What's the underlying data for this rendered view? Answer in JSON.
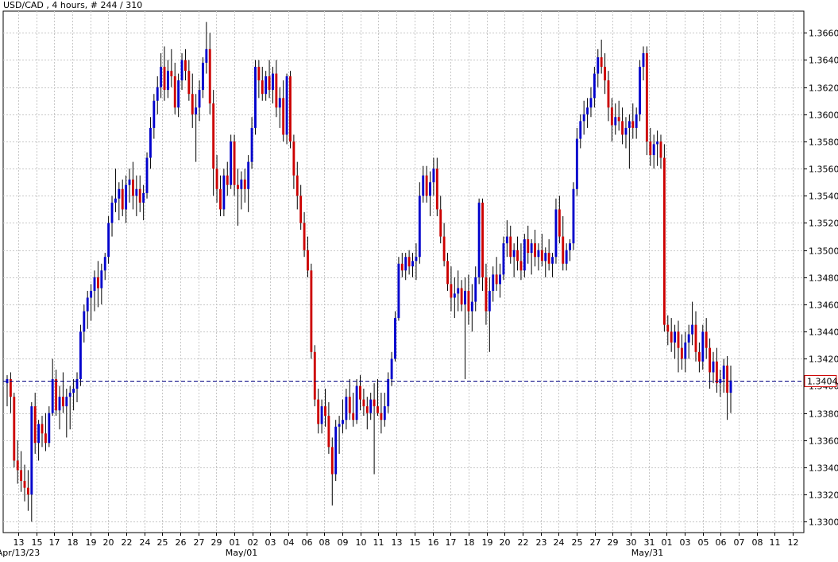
{
  "chart_data": {
    "type": "candlestick",
    "title": "USD/CAD , 4 hours, # 244 / 310",
    "y_ticks": [
      "1.3660",
      "1.3640",
      "1.3620",
      "1.3600",
      "1.3580",
      "1.3560",
      "1.3540",
      "1.3520",
      "1.3500",
      "1.3480",
      "1.3460",
      "1.3440",
      "1.3420",
      "1.3400",
      "1.3380",
      "1.3360",
      "1.3340",
      "1.3320",
      "1.3300"
    ],
    "y_range": [
      1.3292,
      1.3676
    ],
    "current_price": "1.3404",
    "current_value": 1.3404,
    "x_date_labels": [
      "13",
      "15",
      "17",
      "18",
      "19",
      "20",
      "22",
      "24",
      "25",
      "26",
      "27",
      "29",
      "01",
      "02",
      "03",
      "04",
      "06",
      "08",
      "09",
      "10",
      "11",
      "13",
      "15",
      "16",
      "17",
      "18",
      "19",
      "20",
      "22",
      "23",
      "24",
      "25",
      "27",
      "29",
      "30",
      "31",
      "01",
      "03",
      "05",
      "06",
      "07",
      "08",
      "11",
      "12"
    ],
    "x_month_labels": [
      "Apr/13/23",
      "May/01",
      "May/31"
    ],
    "colors": {
      "bull": "#0000cc",
      "bear": "#cc0000",
      "wick": "#000000",
      "grid": "#c8c8c8",
      "price_line": "#000080"
    },
    "candles": [
      [
        1.3402,
        1.3408,
        1.3385,
        1.3405
      ],
      [
        1.3405,
        1.341,
        1.338,
        1.3392
      ],
      [
        1.3392,
        1.3395,
        1.334,
        1.3345
      ],
      [
        1.3345,
        1.336,
        1.3328,
        1.3338
      ],
      [
        1.3338,
        1.3352,
        1.3322,
        1.333
      ],
      [
        1.333,
        1.3342,
        1.3315,
        1.3325
      ],
      [
        1.3325,
        1.3338,
        1.3308,
        1.332
      ],
      [
        1.332,
        1.3388,
        1.33,
        1.3385
      ],
      [
        1.3385,
        1.3395,
        1.335,
        1.3358
      ],
      [
        1.3358,
        1.3375,
        1.3345,
        1.3372
      ],
      [
        1.3372,
        1.3378,
        1.3355,
        1.3365
      ],
      [
        1.3365,
        1.338,
        1.3352,
        1.3358
      ],
      [
        1.3358,
        1.3385,
        1.3355,
        1.338
      ],
      [
        1.338,
        1.342,
        1.3378,
        1.3405
      ],
      [
        1.3405,
        1.3412,
        1.3378,
        1.3382
      ],
      [
        1.3382,
        1.34,
        1.3368,
        1.3392
      ],
      [
        1.3392,
        1.341,
        1.338,
        1.3385
      ],
      [
        1.3385,
        1.3398,
        1.3362,
        1.3392
      ],
      [
        1.3392,
        1.34,
        1.3368,
        1.3395
      ],
      [
        1.3395,
        1.3405,
        1.3382,
        1.3398
      ],
      [
        1.3398,
        1.341,
        1.3388,
        1.3405
      ],
      [
        1.3405,
        1.3445,
        1.34,
        1.344
      ],
      [
        1.344,
        1.346,
        1.3432,
        1.3455
      ],
      [
        1.3455,
        1.347,
        1.3442,
        1.3465
      ],
      [
        1.3465,
        1.3475,
        1.3448,
        1.347
      ],
      [
        1.347,
        1.3485,
        1.3455,
        1.348
      ],
      [
        1.348,
        1.3492,
        1.3458,
        1.3472
      ],
      [
        1.3472,
        1.349,
        1.346,
        1.3485
      ],
      [
        1.3485,
        1.3498,
        1.3478,
        1.3495
      ],
      [
        1.3495,
        1.3525,
        1.349,
        1.352
      ],
      [
        1.352,
        1.354,
        1.351,
        1.3535
      ],
      [
        1.3535,
        1.356,
        1.3528,
        1.3538
      ],
      [
        1.3538,
        1.355,
        1.3522,
        1.3545
      ],
      [
        1.3545,
        1.3552,
        1.3525,
        1.353
      ],
      [
        1.353,
        1.3555,
        1.352,
        1.3548
      ],
      [
        1.3548,
        1.356,
        1.3535,
        1.3552
      ],
      [
        1.3552,
        1.3565,
        1.353,
        1.354
      ],
      [
        1.354,
        1.3555,
        1.3525,
        1.3545
      ],
      [
        1.3545,
        1.3555,
        1.3528,
        1.3535
      ],
      [
        1.3535,
        1.3548,
        1.3522,
        1.3542
      ],
      [
        1.3542,
        1.3572,
        1.3538,
        1.3568
      ],
      [
        1.3568,
        1.3598,
        1.356,
        1.359
      ],
      [
        1.359,
        1.3615,
        1.3582,
        1.361
      ],
      [
        1.361,
        1.3628,
        1.36,
        1.362
      ],
      [
        1.362,
        1.3645,
        1.3612,
        1.3635
      ],
      [
        1.3635,
        1.365,
        1.361,
        1.3618
      ],
      [
        1.3618,
        1.364,
        1.3612,
        1.3632
      ],
      [
        1.3632,
        1.3648,
        1.362,
        1.3628
      ],
      [
        1.3628,
        1.3638,
        1.36,
        1.3605
      ],
      [
        1.3605,
        1.363,
        1.3598,
        1.3625
      ],
      [
        1.3625,
        1.3645,
        1.3618,
        1.364
      ],
      [
        1.364,
        1.3648,
        1.3625,
        1.3632
      ],
      [
        1.3632,
        1.364,
        1.361,
        1.3615
      ],
      [
        1.3615,
        1.363,
        1.359,
        1.36
      ],
      [
        1.36,
        1.3615,
        1.3565,
        1.3605
      ],
      [
        1.3605,
        1.3625,
        1.3595,
        1.3618
      ],
      [
        1.3618,
        1.3642,
        1.3612,
        1.3638
      ],
      [
        1.3638,
        1.3668,
        1.363,
        1.3648
      ],
      [
        1.3648,
        1.366,
        1.36,
        1.3608
      ],
      [
        1.3608,
        1.3618,
        1.354,
        1.356
      ],
      [
        1.356,
        1.357,
        1.3535,
        1.3545
      ],
      [
        1.3545,
        1.3555,
        1.3525,
        1.353
      ],
      [
        1.353,
        1.356,
        1.3525,
        1.3555
      ],
      [
        1.3555,
        1.3565,
        1.354,
        1.3548
      ],
      [
        1.3548,
        1.3585,
        1.3545,
        1.358
      ],
      [
        1.358,
        1.3585,
        1.354,
        1.3548
      ],
      [
        1.3548,
        1.356,
        1.3518,
        1.3545
      ],
      [
        1.3545,
        1.3558,
        1.353,
        1.3552
      ],
      [
        1.3552,
        1.356,
        1.3535,
        1.3545
      ],
      [
        1.3545,
        1.357,
        1.3528,
        1.3565
      ],
      [
        1.3565,
        1.3598,
        1.356,
        1.359
      ],
      [
        1.359,
        1.364,
        1.3585,
        1.3635
      ],
      [
        1.3635,
        1.364,
        1.3612,
        1.3625
      ],
      [
        1.3625,
        1.3635,
        1.361,
        1.3615
      ],
      [
        1.3615,
        1.3632,
        1.361,
        1.3628
      ],
      [
        1.3628,
        1.364,
        1.3612,
        1.3618
      ],
      [
        1.3618,
        1.3635,
        1.3608,
        1.363
      ],
      [
        1.363,
        1.364,
        1.3598,
        1.3605
      ],
      [
        1.3605,
        1.362,
        1.359,
        1.3612
      ],
      [
        1.3612,
        1.3625,
        1.358,
        1.3585
      ],
      [
        1.3585,
        1.363,
        1.3578,
        1.3628
      ],
      [
        1.3628,
        1.3632,
        1.3575,
        1.358
      ],
      [
        1.358,
        1.3585,
        1.3545,
        1.3555
      ],
      [
        1.3555,
        1.3565,
        1.353,
        1.354
      ],
      [
        1.354,
        1.3548,
        1.3515,
        1.352
      ],
      [
        1.352,
        1.3528,
        1.3495,
        1.35
      ],
      [
        1.35,
        1.351,
        1.348,
        1.3485
      ],
      [
        1.3485,
        1.349,
        1.342,
        1.3425
      ],
      [
        1.3425,
        1.343,
        1.3385,
        1.339
      ],
      [
        1.339,
        1.3398,
        1.3365,
        1.3372
      ],
      [
        1.3372,
        1.339,
        1.3365,
        1.3385
      ],
      [
        1.3385,
        1.3398,
        1.337,
        1.3378
      ],
      [
        1.3378,
        1.3388,
        1.335,
        1.3355
      ],
      [
        1.3355,
        1.3362,
        1.3312,
        1.3335
      ],
      [
        1.3335,
        1.3375,
        1.333,
        1.337
      ],
      [
        1.337,
        1.3378,
        1.335,
        1.3372
      ],
      [
        1.3372,
        1.339,
        1.3365,
        1.3375
      ],
      [
        1.3375,
        1.3398,
        1.3368,
        1.3392
      ],
      [
        1.3392,
        1.3405,
        1.3375,
        1.338
      ],
      [
        1.338,
        1.3395,
        1.337,
        1.3375
      ],
      [
        1.3375,
        1.3405,
        1.3372,
        1.34
      ],
      [
        1.34,
        1.3408,
        1.3382,
        1.339
      ],
      [
        1.339,
        1.3398,
        1.3378,
        1.3385
      ],
      [
        1.3385,
        1.3392,
        1.3368,
        1.338
      ],
      [
        1.338,
        1.3395,
        1.3375,
        1.339
      ],
      [
        1.339,
        1.3402,
        1.3335,
        1.3385
      ],
      [
        1.3385,
        1.3405,
        1.3378,
        1.338
      ],
      [
        1.338,
        1.3395,
        1.3365,
        1.3375
      ],
      [
        1.3375,
        1.3395,
        1.337,
        1.3385
      ],
      [
        1.3385,
        1.341,
        1.338,
        1.3405
      ],
      [
        1.3405,
        1.3425,
        1.34,
        1.342
      ],
      [
        1.342,
        1.3455,
        1.3418,
        1.345
      ],
      [
        1.345,
        1.3495,
        1.3448,
        1.349
      ],
      [
        1.349,
        1.3498,
        1.348,
        1.3485
      ],
      [
        1.3485,
        1.3498,
        1.3478,
        1.3495
      ],
      [
        1.3495,
        1.35,
        1.3482,
        1.3488
      ],
      [
        1.3488,
        1.3498,
        1.348,
        1.3492
      ],
      [
        1.3492,
        1.3505,
        1.3478,
        1.3495
      ],
      [
        1.3495,
        1.355,
        1.349,
        1.354
      ],
      [
        1.354,
        1.3562,
        1.3535,
        1.3555
      ],
      [
        1.3555,
        1.3562,
        1.3535,
        1.354
      ],
      [
        1.354,
        1.3558,
        1.3525,
        1.355
      ],
      [
        1.355,
        1.3568,
        1.354,
        1.356
      ],
      [
        1.356,
        1.3568,
        1.3525,
        1.353
      ],
      [
        1.353,
        1.354,
        1.3505,
        1.351
      ],
      [
        1.351,
        1.352,
        1.3488,
        1.3492
      ],
      [
        1.3492,
        1.3498,
        1.347,
        1.3475
      ],
      [
        1.3475,
        1.3488,
        1.3455,
        1.3465
      ],
      [
        1.3465,
        1.348,
        1.345,
        1.3468
      ],
      [
        1.3468,
        1.3485,
        1.3455,
        1.3472
      ],
      [
        1.3472,
        1.3478,
        1.3455,
        1.346
      ],
      [
        1.346,
        1.348,
        1.3405,
        1.347
      ],
      [
        1.347,
        1.3482,
        1.3445,
        1.3455
      ],
      [
        1.3455,
        1.3475,
        1.344,
        1.3462
      ],
      [
        1.3462,
        1.3488,
        1.3455,
        1.348
      ],
      [
        1.348,
        1.3538,
        1.3475,
        1.3535
      ],
      [
        1.3535,
        1.3538,
        1.347,
        1.348
      ],
      [
        1.348,
        1.349,
        1.3445,
        1.3455
      ],
      [
        1.3455,
        1.348,
        1.3425,
        1.347
      ],
      [
        1.347,
        1.3488,
        1.3462,
        1.3482
      ],
      [
        1.3482,
        1.3495,
        1.347,
        1.3475
      ],
      [
        1.3475,
        1.349,
        1.3465,
        1.3482
      ],
      [
        1.3482,
        1.351,
        1.3478,
        1.3505
      ],
      [
        1.3505,
        1.3522,
        1.3495,
        1.351
      ],
      [
        1.351,
        1.3518,
        1.349,
        1.3495
      ],
      [
        1.3495,
        1.3505,
        1.348,
        1.35
      ],
      [
        1.35,
        1.351,
        1.3485,
        1.3492
      ],
      [
        1.3492,
        1.3505,
        1.3478,
        1.3485
      ],
      [
        1.3485,
        1.3512,
        1.348,
        1.3508
      ],
      [
        1.3508,
        1.3518,
        1.349,
        1.3498
      ],
      [
        1.3498,
        1.3508,
        1.3482,
        1.3505
      ],
      [
        1.3505,
        1.3515,
        1.3488,
        1.3495
      ],
      [
        1.3495,
        1.3505,
        1.3485,
        1.35
      ],
      [
        1.35,
        1.3512,
        1.3488,
        1.3492
      ],
      [
        1.3492,
        1.3502,
        1.348,
        1.3498
      ],
      [
        1.3498,
        1.3508,
        1.3485,
        1.349
      ],
      [
        1.349,
        1.3498,
        1.348,
        1.3495
      ],
      [
        1.3495,
        1.3538,
        1.349,
        1.353
      ],
      [
        1.353,
        1.354,
        1.3505,
        1.351
      ],
      [
        1.351,
        1.3525,
        1.3485,
        1.349
      ],
      [
        1.349,
        1.3505,
        1.3485,
        1.35
      ],
      [
        1.35,
        1.3508,
        1.3492,
        1.3505
      ],
      [
        1.3505,
        1.355,
        1.35,
        1.3545
      ],
      [
        1.3545,
        1.359,
        1.354,
        1.3582
      ],
      [
        1.3582,
        1.36,
        1.3575,
        1.3595
      ],
      [
        1.3595,
        1.361,
        1.3585,
        1.36
      ],
      [
        1.36,
        1.3612,
        1.359,
        1.3605
      ],
      [
        1.3605,
        1.362,
        1.3598,
        1.3612
      ],
      [
        1.3612,
        1.3635,
        1.3605,
        1.363
      ],
      [
        1.363,
        1.3648,
        1.362,
        1.3642
      ],
      [
        1.3642,
        1.3655,
        1.363,
        1.3635
      ],
      [
        1.3635,
        1.3645,
        1.3615,
        1.3625
      ],
      [
        1.3625,
        1.3632,
        1.3595,
        1.3605
      ],
      [
        1.3605,
        1.3612,
        1.358,
        1.3592
      ],
      [
        1.3592,
        1.3608,
        1.3585,
        1.3598
      ],
      [
        1.3598,
        1.361,
        1.3588,
        1.3595
      ],
      [
        1.3595,
        1.3605,
        1.3578,
        1.3585
      ],
      [
        1.3585,
        1.3598,
        1.3575,
        1.359
      ],
      [
        1.359,
        1.36,
        1.356,
        1.3595
      ],
      [
        1.3595,
        1.3608,
        1.3582,
        1.359
      ],
      [
        1.359,
        1.3605,
        1.3582,
        1.36
      ],
      [
        1.36,
        1.364,
        1.3595,
        1.3635
      ],
      [
        1.3635,
        1.365,
        1.3625,
        1.3645
      ],
      [
        1.3645,
        1.365,
        1.357,
        1.358
      ],
      [
        1.358,
        1.359,
        1.3562,
        1.357
      ],
      [
        1.357,
        1.3585,
        1.356,
        1.3578
      ],
      [
        1.3578,
        1.3588,
        1.3562,
        1.358
      ],
      [
        1.358,
        1.3585,
        1.356,
        1.3568
      ],
      [
        1.3568,
        1.3578,
        1.344,
        1.3445
      ],
      [
        1.3445,
        1.3452,
        1.343,
        1.344
      ],
      [
        1.344,
        1.345,
        1.3425,
        1.3432
      ],
      [
        1.3432,
        1.3445,
        1.342,
        1.344
      ],
      [
        1.344,
        1.3448,
        1.341,
        1.3428
      ],
      [
        1.3428,
        1.3438,
        1.3412,
        1.342
      ],
      [
        1.342,
        1.344,
        1.341,
        1.3432
      ],
      [
        1.3432,
        1.3445,
        1.342,
        1.3438
      ],
      [
        1.3438,
        1.3462,
        1.343,
        1.3445
      ],
      [
        1.3445,
        1.3455,
        1.3418,
        1.3425
      ],
      [
        1.3425,
        1.3432,
        1.341,
        1.3418
      ],
      [
        1.3418,
        1.3445,
        1.3412,
        1.344
      ],
      [
        1.344,
        1.345,
        1.342,
        1.3428
      ],
      [
        1.3428,
        1.3435,
        1.3398,
        1.341
      ],
      [
        1.341,
        1.3425,
        1.3402,
        1.3418
      ],
      [
        1.3418,
        1.3428,
        1.3395,
        1.3402
      ],
      [
        1.3402,
        1.3412,
        1.3392,
        1.3405
      ],
      [
        1.3405,
        1.342,
        1.3395,
        1.3415
      ],
      [
        1.3415,
        1.3422,
        1.3375,
        1.3395
      ],
      [
        1.3395,
        1.3415,
        1.338,
        1.3404
      ]
    ]
  }
}
